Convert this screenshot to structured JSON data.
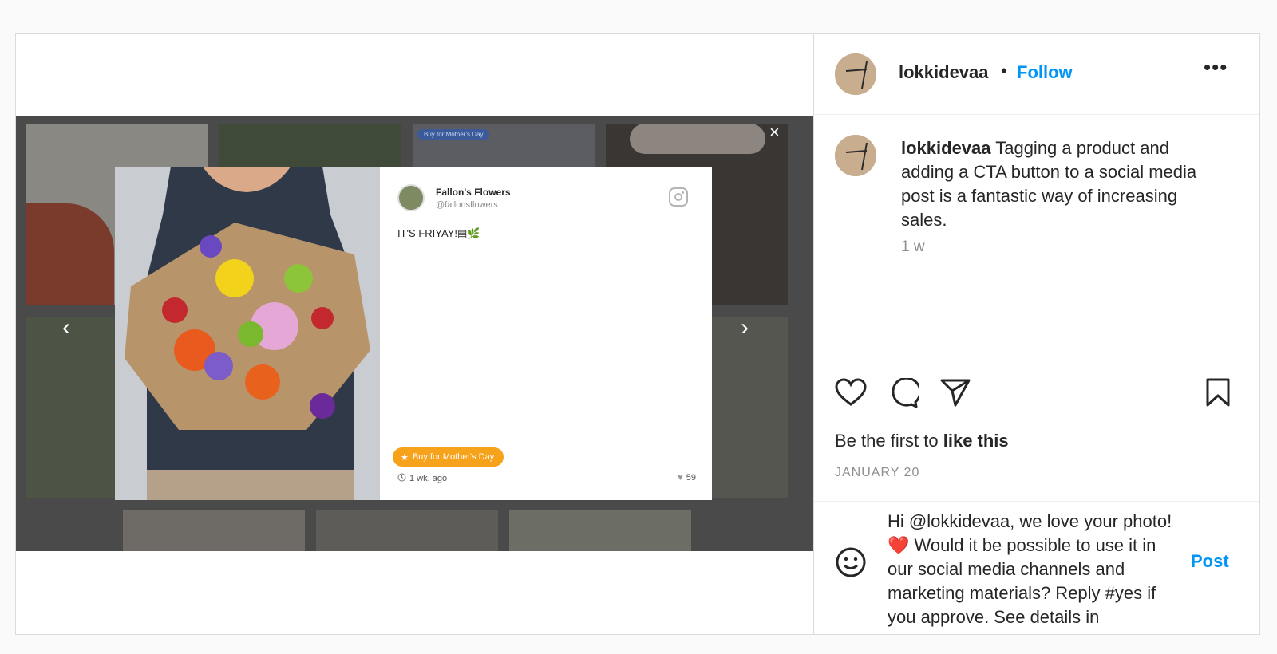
{
  "post": {
    "username": "lokkidevaa",
    "follow_label": "Follow",
    "separator": "•",
    "more_label": "•••",
    "caption_user": "lokkidevaa",
    "caption_text": " Tagging a product and adding a CTA button to a social media post is a fantastic way of increasing sales.",
    "caption_time": "1 w",
    "likes_prefix": "Be the first to ",
    "likes_link": "like this",
    "date": "JANUARY 20",
    "comment_draft": "Hi @lokkidevaa, we love your photo! ❤️ Would it be possible to use it in our social media channels and marketing materials? Reply #yes if you approve. See details in",
    "post_label": "Post"
  },
  "media": {
    "close_label": "×",
    "prev_label": "‹",
    "next_label": "›",
    "modal": {
      "account_name": "Fallon's Flowers",
      "account_handle": "@fallonsflowers",
      "caption": "IT'S FRIYAY!▤🌿",
      "cta_label": "Buy for Mother's Day",
      "time": "1 wk. ago",
      "likes": "59"
    },
    "tile_badge": "Buy for Mother's Day"
  },
  "colors": {
    "accent": "#0095f6",
    "cta": "#f7a21b"
  }
}
